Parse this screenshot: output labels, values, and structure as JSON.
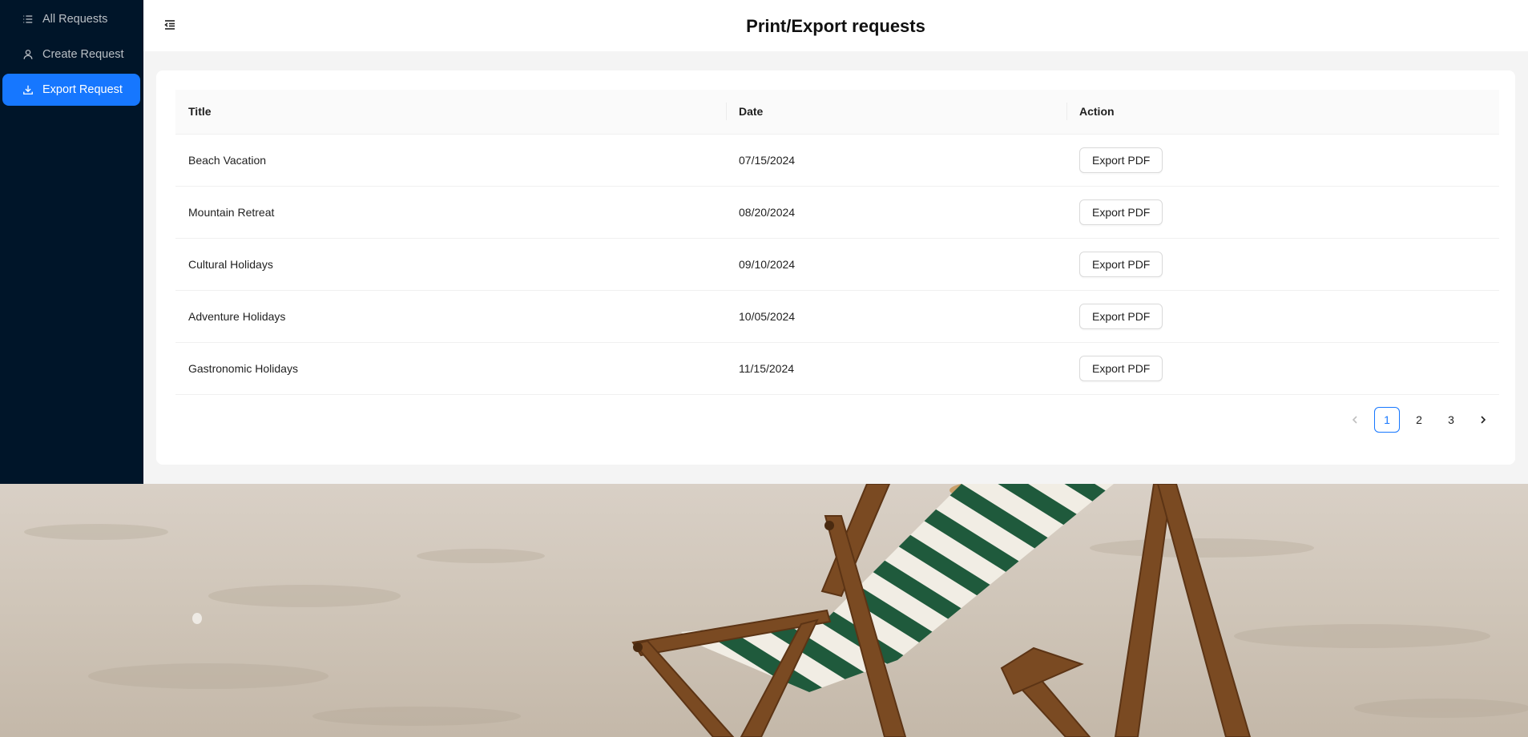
{
  "sidebar": {
    "items": [
      {
        "label": "All Requests",
        "icon": "list-icon",
        "active": false
      },
      {
        "label": "Create Request",
        "icon": "user-icon",
        "active": false
      },
      {
        "label": "Export Request",
        "icon": "download-icon",
        "active": true
      }
    ]
  },
  "header": {
    "title": "Print/Export requests",
    "collapse_icon": "menu-fold-icon"
  },
  "table": {
    "columns": [
      "Title",
      "Date",
      "Action"
    ],
    "rows": [
      {
        "title": "Beach Vacation",
        "date": "07/15/2024",
        "action": "Export PDF"
      },
      {
        "title": "Mountain Retreat",
        "date": "08/20/2024",
        "action": "Export PDF"
      },
      {
        "title": "Cultural Holidays",
        "date": "09/10/2024",
        "action": "Export PDF"
      },
      {
        "title": "Adventure Holidays",
        "date": "10/05/2024",
        "action": "Export PDF"
      },
      {
        "title": "Gastronomic Holidays",
        "date": "11/15/2024",
        "action": "Export PDF"
      }
    ]
  },
  "pagination": {
    "pages": [
      "1",
      "2",
      "3"
    ],
    "current": "1",
    "prev_icon": "chevron-left-icon",
    "next_icon": "chevron-right-icon"
  },
  "colors": {
    "sidebar_bg": "#001529",
    "accent": "#1677ff",
    "page_bg": "#f4f4f4"
  },
  "background_image": "beach-chair-on-sand"
}
